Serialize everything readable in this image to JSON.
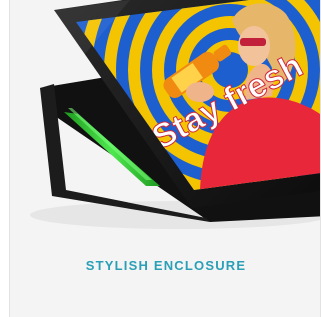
{
  "card": {
    "caption": "STYLISH ENCLOSURE",
    "image_screen_text": "Stay fresh",
    "caption_color": "#2a9fb6",
    "status_light_color": "#3fd23f"
  }
}
